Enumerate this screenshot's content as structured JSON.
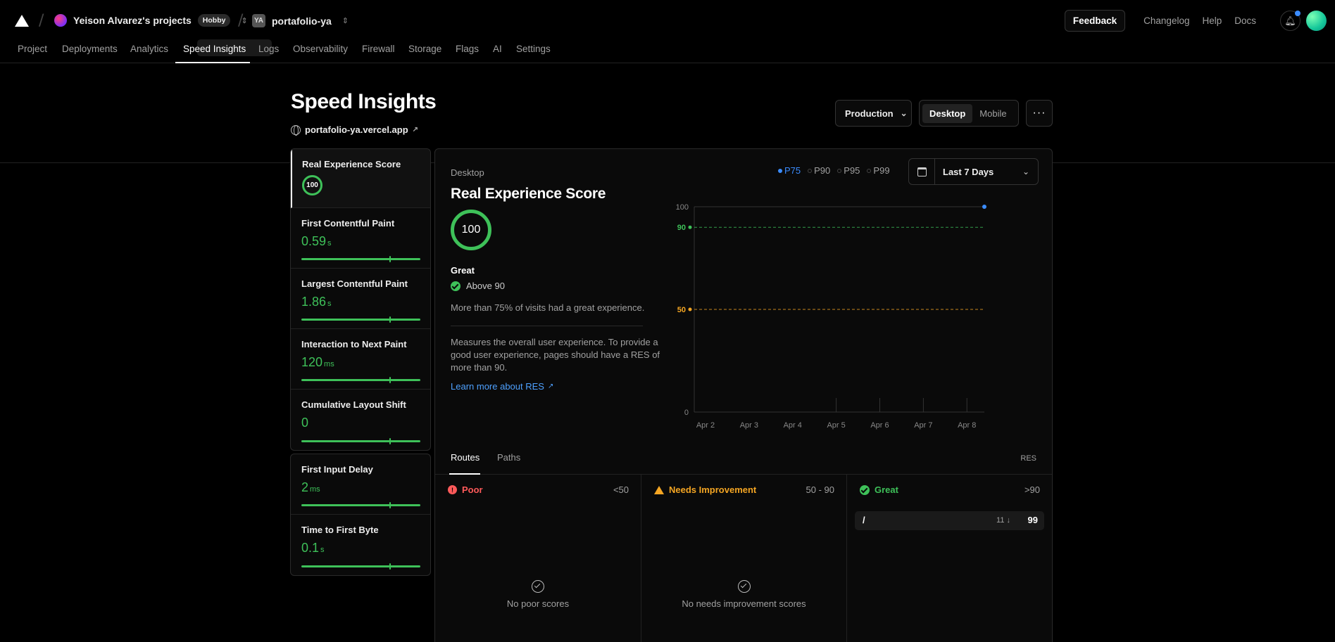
{
  "header": {
    "team_name": "Yeison Alvarez's projects",
    "plan_badge": "Hobby",
    "project_initials": "YA",
    "project_name": "portafolio-ya",
    "feedback": "Feedback",
    "changelog": "Changelog",
    "help": "Help",
    "docs": "Docs"
  },
  "nav": {
    "items": [
      "Project",
      "Deployments",
      "Analytics",
      "Speed Insights",
      "Logs",
      "Observability",
      "Firewall",
      "Storage",
      "Flags",
      "AI",
      "Settings"
    ],
    "active": "Speed Insights"
  },
  "page": {
    "title": "Speed Insights",
    "site": "portafolio-ya.vercel.app",
    "environment": "Production",
    "devices": [
      "Desktop",
      "Mobile"
    ],
    "active_device": "Desktop",
    "more": "···"
  },
  "metrics": [
    {
      "name": "Real Experience Score",
      "value": "100",
      "unit": ""
    },
    {
      "name": "First Contentful Paint",
      "value": "0.59",
      "unit": "s"
    },
    {
      "name": "Largest Contentful Paint",
      "value": "1.86",
      "unit": "s"
    },
    {
      "name": "Interaction to Next Paint",
      "value": "120",
      "unit": "ms"
    },
    {
      "name": "Cumulative Layout Shift",
      "value": "0",
      "unit": ""
    },
    {
      "name": "First Input Delay",
      "value": "2",
      "unit": "ms"
    },
    {
      "name": "Time to First Byte",
      "value": "0.1",
      "unit": "s"
    }
  ],
  "detail": {
    "device": "Desktop",
    "title": "Real Experience Score",
    "score": "100",
    "rating": "Great",
    "threshold": "Above 90",
    "visits_text": "More than 75% of visits had a great experience.",
    "description": "Measures the overall user experience. To provide a good user experience, pages should have a RES of more than 90.",
    "learn_more": "Learn more about RES",
    "percentiles": [
      "P75",
      "P90",
      "P95",
      "P99"
    ],
    "active_percentile": "P75",
    "date_range": "Last 7 Days"
  },
  "chart_data": {
    "type": "line",
    "x": [
      "Apr 2",
      "Apr 3",
      "Apr 4",
      "Apr 5",
      "Apr 6",
      "Apr 7",
      "Apr 8"
    ],
    "y_ticks": [
      "100",
      "0"
    ],
    "ylim": [
      0,
      100
    ],
    "thresholds": [
      {
        "value": 90,
        "label": "90",
        "color": "#3ec159"
      },
      {
        "value": 50,
        "label": "50",
        "color": "#f5a623"
      }
    ],
    "series": [
      {
        "points": [
          {
            "x": "Apr 8",
            "y": 100
          }
        ],
        "color": "#3b8cff"
      }
    ]
  },
  "routes": {
    "tabs": [
      "Routes",
      "Paths"
    ],
    "active_tab": "Routes",
    "metric_label": "RES",
    "poor": {
      "label": "Poor",
      "range": "<50",
      "empty": "No poor scores"
    },
    "needs": {
      "label": "Needs Improvement",
      "range": "50 - 90",
      "empty": "No needs improvement scores"
    },
    "great": {
      "label": "Great",
      "range": ">90",
      "rows": [
        {
          "path": "/",
          "count": "11",
          "score": "99"
        }
      ]
    }
  }
}
